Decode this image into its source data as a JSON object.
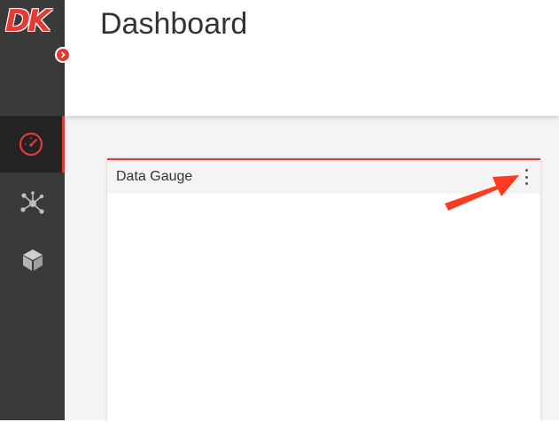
{
  "logo": {
    "text": "DK"
  },
  "header": {
    "title": "Dashboard"
  },
  "sidebar": {
    "items": [
      {
        "icon": "gauge-icon",
        "active": true
      },
      {
        "icon": "network-icon",
        "active": false
      },
      {
        "icon": "cube-icon",
        "active": false
      }
    ]
  },
  "card": {
    "title": "Data Gauge"
  },
  "colors": {
    "accent": "#e53935",
    "sidebar_bg": "#3a3a3a",
    "sidebar_active_bg": "#232323",
    "content_bg": "#f4f4f4",
    "annotation_arrow": "#ff3b1f"
  }
}
